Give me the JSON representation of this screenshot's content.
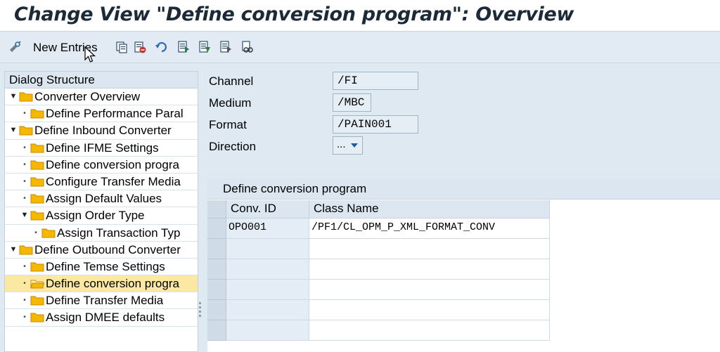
{
  "window": {
    "title": "Change View \"Define conversion program\": Overview"
  },
  "toolbar": {
    "new_entries_label": "New Entries",
    "icons": [
      "details-icon",
      "copy-icon",
      "delete-icon",
      "undo-icon",
      "select-all-icon",
      "select-block-icon",
      "deselect-all-icon",
      "find-icon"
    ]
  },
  "dialog_structure": {
    "header": "Dialog Structure",
    "items": [
      {
        "label": "Converter Overview",
        "expander": "expanded"
      },
      {
        "label": "Define Performance Paral",
        "expander": "leaf"
      },
      {
        "label": "Define Inbound Converter",
        "expander": "expanded"
      },
      {
        "label": "Define IFME Settings",
        "expander": "leaf"
      },
      {
        "label": "Define conversion progra",
        "expander": "leaf"
      },
      {
        "label": "Configure Transfer Media",
        "expander": "leaf"
      },
      {
        "label": "Assign Default Values",
        "expander": "leaf"
      },
      {
        "label": "Assign Order Type",
        "expander": "expanded"
      },
      {
        "label": "Assign Transaction Typ",
        "expander": "leaf"
      },
      {
        "label": "Define Outbound Converter",
        "expander": "expanded"
      },
      {
        "label": "Define Temse Settings",
        "expander": "leaf"
      },
      {
        "label": "Define conversion progra",
        "expander": "leaf",
        "selected": true
      },
      {
        "label": "Define Transfer Media",
        "expander": "leaf"
      },
      {
        "label": "Assign DMEE defaults",
        "expander": "leaf"
      }
    ]
  },
  "fields": {
    "channel": {
      "label": "Channel",
      "value": "/FI"
    },
    "medium": {
      "label": "Medium",
      "value": "/MBC"
    },
    "format": {
      "label": "Format",
      "value": "/PAIN001"
    },
    "direction": {
      "label": "Direction",
      "value": "..."
    }
  },
  "table": {
    "title": "Define conversion program",
    "columns": [
      "Conv. ID",
      "Class Name"
    ],
    "rows": [
      [
        "OPO001",
        "/PF1/CL_OPM_P_XML_FORMAT_CONV"
      ],
      [
        "",
        ""
      ],
      [
        "",
        ""
      ],
      [
        "",
        ""
      ],
      [
        "",
        ""
      ],
      [
        "",
        ""
      ]
    ]
  },
  "colors": {
    "selected_row": "#fbe9a2",
    "folder_fill": "#f5b800",
    "folder_outline": "#c98a00",
    "dropdown_arrow": "#1e5f9c"
  }
}
